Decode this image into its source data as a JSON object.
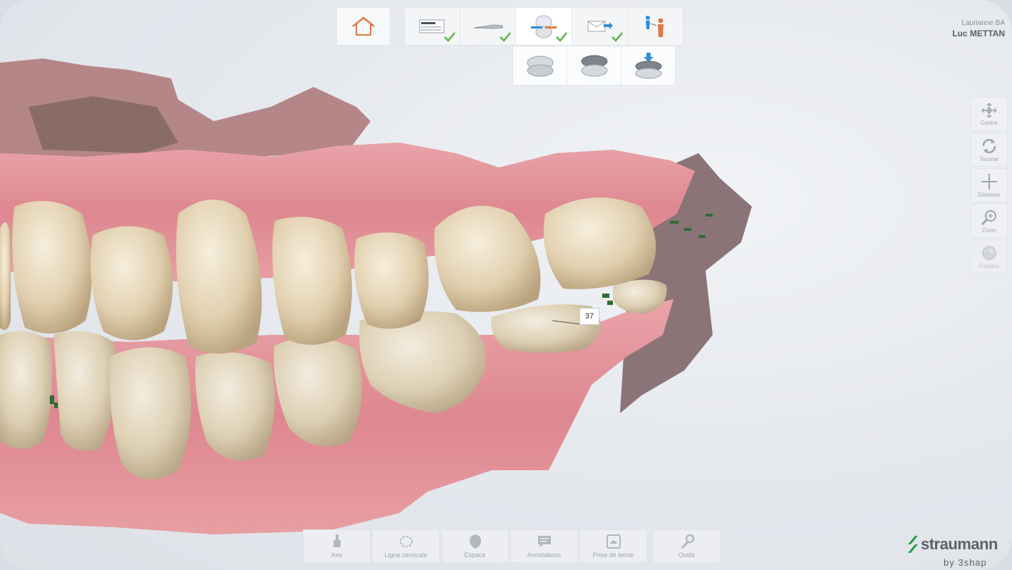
{
  "patient": {
    "line1": "Laurianne BA",
    "line2": "Luc METTAN"
  },
  "workflow": {
    "home_icon": "home-icon",
    "steps": [
      {
        "icon": "patient-form-icon",
        "done": true
      },
      {
        "icon": "scanner-wand-icon",
        "done": true
      },
      {
        "icon": "bite-scan-icon",
        "done": true,
        "active": true
      },
      {
        "icon": "send-icon",
        "done": true
      },
      {
        "icon": "handover-icon",
        "done": false
      }
    ],
    "substeps": [
      {
        "icon": "upper-jaw-icon"
      },
      {
        "icon": "lower-jaw-icon"
      },
      {
        "icon": "bite-align-icon"
      }
    ]
  },
  "right_tools": [
    {
      "label": "Centre",
      "icon": "center-icon"
    },
    {
      "label": "Tourner",
      "icon": "rotate-icon"
    },
    {
      "label": "Déplacer",
      "icon": "move-icon"
    },
    {
      "label": "Zoom",
      "icon": "zoom-icon"
    },
    {
      "label": "Couleur",
      "icon": "color-icon"
    }
  ],
  "bottom_tools": [
    {
      "label": "Axe",
      "icon": "axis-icon"
    },
    {
      "label": "Ligne cervicale",
      "icon": "cervical-line-icon"
    },
    {
      "label": "Espace",
      "icon": "space-icon"
    },
    {
      "label": "Annotations",
      "icon": "annotations-icon"
    },
    {
      "label": "Prise de teinte",
      "icon": "shade-icon"
    },
    {
      "label": "Outils",
      "icon": "wrench-icon"
    }
  ],
  "scan": {
    "tooth_number": "37"
  },
  "brand": {
    "name": "straumann",
    "by": "by 3shap"
  },
  "colors": {
    "check": "#5db34a",
    "accent_blue": "#2f8fd8",
    "home_orange": "#e07a45",
    "brand_green": "#2a9d4b"
  }
}
